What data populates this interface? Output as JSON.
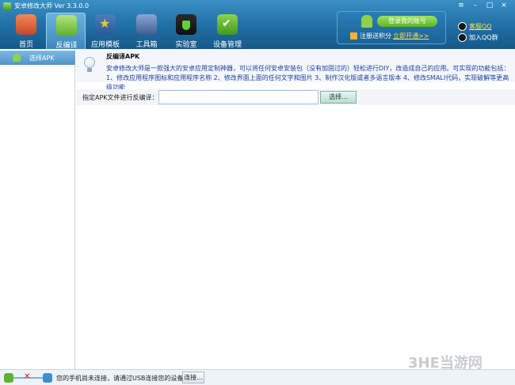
{
  "app": {
    "title": "安卓修改大师 Ver 3.3.0.0"
  },
  "toolbar": {
    "items": [
      {
        "label": "首页",
        "icon": "home-icon",
        "color": "#e65a3a"
      },
      {
        "label": "反编译",
        "icon": "android-icon",
        "color": "#8fd14f",
        "active": true
      },
      {
        "label": "应用模板",
        "icon": "star-icon",
        "color": "#f3b12a"
      },
      {
        "label": "工具箱",
        "icon": "toolbox-icon",
        "color": "#6a86b3"
      },
      {
        "label": "实验室",
        "icon": "flask-icon",
        "color": "#3fae3a"
      },
      {
        "label": "设备管理",
        "icon": "device-check-icon",
        "color": "#4fb33a"
      }
    ]
  },
  "account": {
    "login_label": "登录我的账号",
    "register_text": "注册送积分",
    "open_link": "立即开通>>"
  },
  "qq": {
    "support_label": "客服QQ",
    "group_label": "加入QQ群"
  },
  "sidebar": {
    "items": [
      {
        "label": "选择APK"
      }
    ]
  },
  "info": {
    "title": "反编译APK",
    "description": "安卓修改大师是一款强大的安卓应用定制神器，可以将任何安卓安装包（没有加固过的）轻松进行DIY，改造成自己的应用。可实现的功能包括：1、修改应用程序图标和应用程序名称 2、修改界面上面的任何文字和图片 3、制作汉化版或者多语言版本 4、修改SMALI代码，实现破解等更高级功能"
  },
  "apk_select": {
    "label": "指定APK文件进行反编译：",
    "value": "",
    "button_label": "选择..."
  },
  "status": {
    "text": "您的手机尚未连接，请通过USB连接您的设备...",
    "connect_label": "连接..."
  },
  "watermark": "3HE当游网",
  "colors": {
    "header": "#1f6ea3",
    "accent_green": "#5fb22c",
    "link_yellow": "#ffe24a"
  }
}
